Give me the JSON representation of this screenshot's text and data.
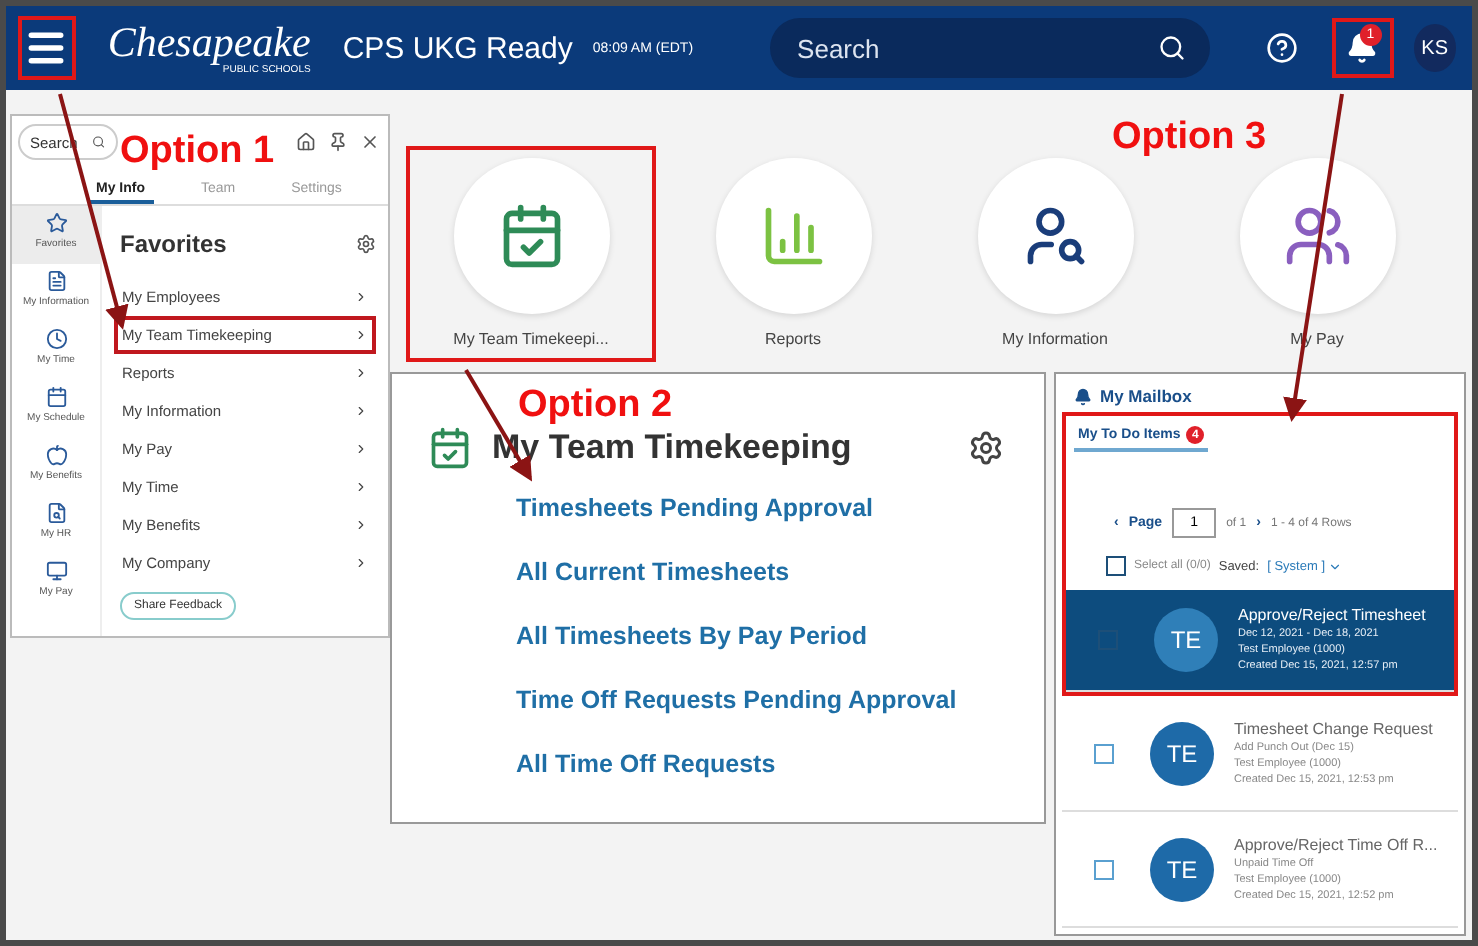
{
  "header": {
    "menu_highlighted": true,
    "logo": "Chesapeake",
    "logo_sub": "PUBLIC SCHOOLS",
    "app_name": "CPS UKG Ready",
    "time": "08:09 AM (EDT)",
    "search": {
      "placeholder": "Search"
    },
    "notifications": {
      "badge": "1",
      "highlighted": true
    },
    "avatar": "KS"
  },
  "flyout": {
    "search": {
      "placeholder": "Search"
    },
    "tabs": [
      {
        "label": "My Info",
        "selected": true
      },
      {
        "label": "Team",
        "selected": false
      },
      {
        "label": "Settings",
        "selected": false
      }
    ],
    "rail": [
      {
        "label": "Favorites",
        "selected": true
      },
      {
        "label": "My Information",
        "selected": false
      },
      {
        "label": "My Time",
        "selected": false
      },
      {
        "label": "My Schedule",
        "selected": false
      },
      {
        "label": "My Benefits",
        "selected": false
      },
      {
        "label": "My HR",
        "selected": false
      },
      {
        "label": "My Pay",
        "selected": false
      }
    ],
    "heading": "Favorites",
    "items": [
      {
        "label": "My Employees",
        "highlighted": false
      },
      {
        "label": "My Team Timekeeping",
        "highlighted": true
      },
      {
        "label": "Reports",
        "highlighted": false
      },
      {
        "label": "My Information",
        "highlighted": false
      },
      {
        "label": "My Pay",
        "highlighted": false
      },
      {
        "label": "My Time",
        "highlighted": false
      },
      {
        "label": "My Benefits",
        "highlighted": false
      },
      {
        "label": "My Company",
        "highlighted": false
      }
    ],
    "feedback_button": "Share Feedback"
  },
  "tiles": [
    {
      "label": "My Team Timekeepi...",
      "highlighted": true
    },
    {
      "label": "Reports",
      "highlighted": false
    },
    {
      "label": "My Information",
      "highlighted": false
    },
    {
      "label": "My Pay",
      "highlighted": false
    }
  ],
  "card": {
    "title": "My Team Timekeeping",
    "links": [
      "Timesheets Pending Approval",
      "All Current Timesheets",
      "All Timesheets By Pay Period",
      "Time Off Requests Pending Approval",
      "All Time Off Requests"
    ]
  },
  "mailbox": {
    "title": "My Mailbox",
    "highlighted": true,
    "tab": "My To Do Items",
    "tab_badge": "4",
    "pager": {
      "prev": "‹",
      "label": "Page",
      "page": "1",
      "of": "of 1",
      "next": "›",
      "rows": "1 - 4 of 4 Rows"
    },
    "select_all": {
      "label": "Select all (0/0)",
      "checked": false
    },
    "saved_label": "Saved:",
    "saved_value": "[ System ]",
    "items": [
      {
        "initials": "TE",
        "title": "Approve/Reject Timesheet",
        "lines": [
          "Dec 12, 2021 - Dec 18, 2021",
          "Test Employee (1000)",
          "Created Dec 15, 2021, 12:57 pm"
        ],
        "selected": true,
        "checked": false
      },
      {
        "initials": "TE",
        "title": "Timesheet Change Request",
        "lines": [
          "Add Punch Out (Dec 15)",
          "Test Employee (1000)",
          "Created Dec 15, 2021, 12:53 pm"
        ],
        "selected": false,
        "checked": false
      },
      {
        "initials": "TE",
        "title": "Approve/Reject Time Off R...",
        "lines": [
          "Unpaid Time Off",
          "Test Employee (1000)",
          "Created Dec 15, 2021, 12:52 pm"
        ],
        "selected": false,
        "checked": false
      }
    ]
  },
  "annotations": [
    {
      "label": "Option 1"
    },
    {
      "label": "Option 2"
    },
    {
      "label": "Option 3"
    }
  ]
}
